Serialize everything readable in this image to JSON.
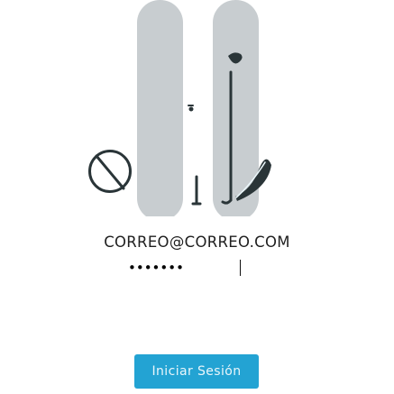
{
  "login": {
    "email": "CORREO@CORREO.COM",
    "password_masked": "•••••••",
    "submit_label": "Iniciar Sesión"
  },
  "colors": {
    "accent": "#23a3d3",
    "line": "#2a3538",
    "bar": "#c8cdd0",
    "dot": "#ebf7fb"
  }
}
